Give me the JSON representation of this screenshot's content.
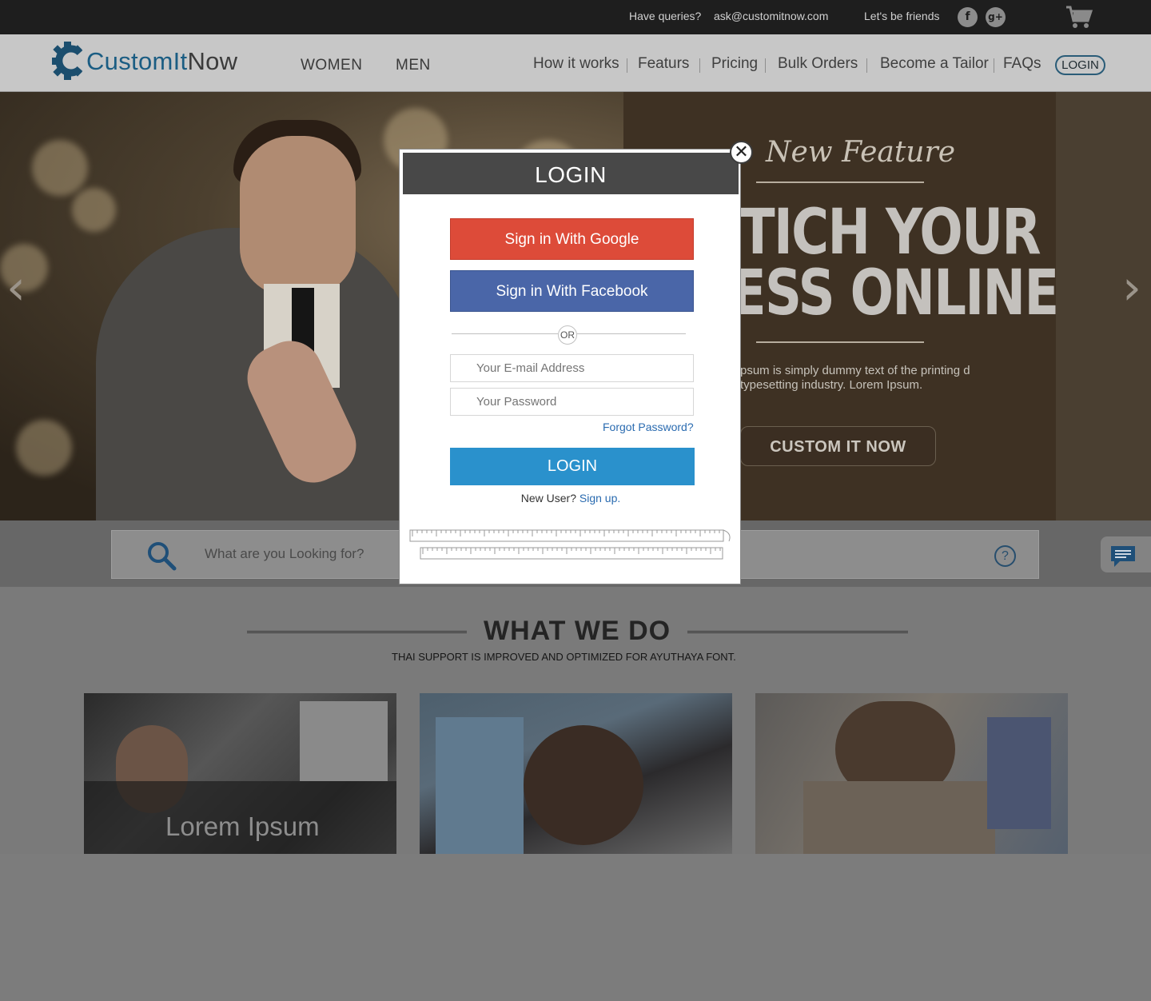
{
  "topbar": {
    "queries_label": "Have queries?",
    "email": "ask@customitnow.com",
    "friends_label": "Let's be friends",
    "facebook_glyph": "f",
    "googleplus_glyph": "g+"
  },
  "header": {
    "logo_part1": "CustomIt",
    "logo_part2": "Now",
    "categories": [
      "WOMEN",
      "MEN"
    ],
    "nav": [
      "How it works",
      "Featurs",
      "Pricing",
      "Bulk Orders",
      "Become a Tailor",
      "FAQs"
    ],
    "login_label": "LOGIN"
  },
  "hero": {
    "feature_title": "New Feature",
    "headline_1": "TICH YOUR",
    "headline_2": "ESS ONLINE",
    "description": "psum is simply dummy text of the printing d typesetting industry. Lorem Ipsum.",
    "cta_label": "CUSTOM IT NOW",
    "prev_arrow": "‹",
    "next_arrow": "›"
  },
  "search": {
    "placeholder": "What are you Looking for?",
    "help_glyph": "?"
  },
  "what_we_do": {
    "title": "WHAT WE DO",
    "subtitle": "THAI SUPPORT IS IMPROVED AND OPTIMIZED FOR AYUTHAYA FONT.",
    "cards": [
      {
        "title": "Lorem Ipsum"
      }
    ]
  },
  "modal": {
    "title": "LOGIN",
    "close_glyph": "✕",
    "google_label": "Sign in With Google",
    "facebook_label": "Sign in With Facebook",
    "or_label": "OR",
    "email_placeholder": "Your E-mail Address",
    "password_placeholder": "Your Password",
    "forgot_label": "Forgot Password?",
    "login_label": "LOGIN",
    "new_user_label": "New User?",
    "signup_label": "Sign up."
  },
  "colors": {
    "google": "#dd4b39",
    "facebook": "#4a66a8",
    "primary": "#2a91cc",
    "link": "#2a6bb0",
    "modal_header": "#484848"
  },
  "icons": [
    "facebook-icon",
    "googleplus-icon",
    "cart-icon",
    "gear-icon",
    "search-icon",
    "help-icon",
    "chat-icon",
    "close-icon",
    "measuring-tape-icon"
  ]
}
